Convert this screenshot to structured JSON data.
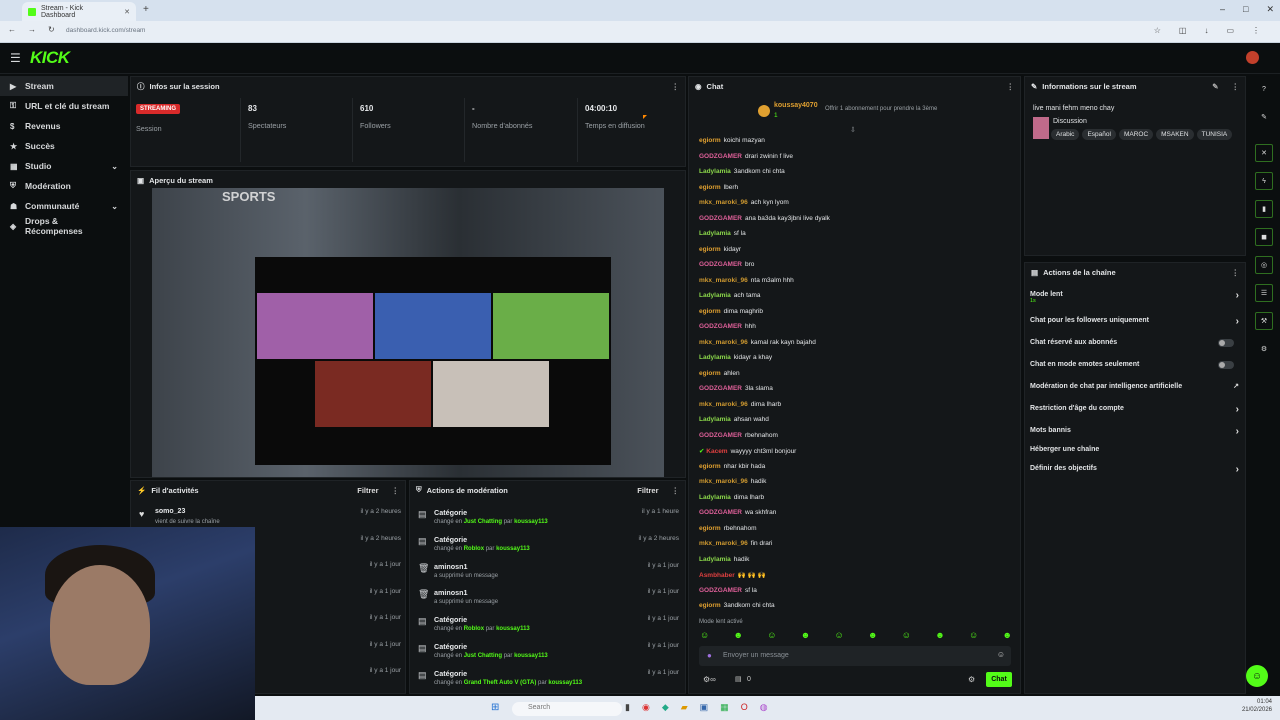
{
  "browser": {
    "tab_title": "Stream - Kick Dashboard",
    "new_tab": "+",
    "url": "dashboard.kick.com/stream",
    "win_controls": [
      "–",
      "□",
      "✕"
    ]
  },
  "app": {
    "logo": "KICK",
    "menu_icon": "hamburger-icon"
  },
  "sidebar": {
    "items": [
      {
        "label": "Stream",
        "icon": "video-icon",
        "active": true
      },
      {
        "label": "URL et clé du stream",
        "icon": "key-icon"
      },
      {
        "label": "Revenus",
        "icon": "money-icon"
      },
      {
        "label": "Succès",
        "icon": "trophy-icon"
      },
      {
        "label": "Studio",
        "icon": "studio-icon",
        "expand": true
      },
      {
        "label": "Modération",
        "icon": "shield-icon"
      },
      {
        "label": "Communauté",
        "icon": "users-icon",
        "expand": true
      },
      {
        "label": "Drops & Récompenses",
        "icon": "gift-icon"
      }
    ]
  },
  "session": {
    "title": "Infos sur la session",
    "badge": "STREAMING",
    "badge_label": "Session",
    "stats": [
      {
        "value": "83",
        "label": "Spectateurs"
      },
      {
        "value": "610",
        "label": "Followers"
      },
      {
        "value": "-",
        "label": "Nombre d'abonnés"
      },
      {
        "value": "04:00:10",
        "label": "Temps en diffusion"
      }
    ]
  },
  "preview": {
    "title": "Aperçu du stream",
    "overlay_text": "SPORTS"
  },
  "activity": {
    "title": "Fil d'activités",
    "filter": "Filtrer",
    "items": [
      {
        "user": "somo_23",
        "text": "vient de suivre la chaîne",
        "time": "il y a 2 heures"
      },
      {
        "time": "il y a 2 heures"
      },
      {
        "time": "il y a 1 jour"
      },
      {
        "time": "il y a 1 jour"
      },
      {
        "time": "il y a 1 jour"
      },
      {
        "time": "il y a 1 jour"
      },
      {
        "time": "il y a 1 jour"
      }
    ]
  },
  "moderation": {
    "title": "Actions de modération",
    "filter": "Filtrer",
    "items": [
      {
        "title": "Catégorie",
        "pre": "changé en",
        "a": "Just Chatting",
        "mid": "par",
        "b": "koussay113",
        "time": "il y a 1 heure",
        "icon": "category-icon"
      },
      {
        "title": "Catégorie",
        "pre": "changé en",
        "a": "Roblox",
        "mid": "par",
        "b": "koussay113",
        "time": "il y a 2 heures",
        "icon": "category-icon"
      },
      {
        "title": "aminosn1",
        "pre": "a supprimé un message",
        "time": "il y a 1 jour",
        "icon": "trash-icon"
      },
      {
        "title": "aminosn1",
        "pre": "a supprimé un message",
        "time": "il y a 1 jour",
        "icon": "trash-icon"
      },
      {
        "title": "Catégorie",
        "pre": "changé en",
        "a": "Roblox",
        "mid": "par",
        "b": "koussay113",
        "time": "il y a 1 jour",
        "icon": "category-icon"
      },
      {
        "title": "Catégorie",
        "pre": "changé en",
        "a": "Just Chatting",
        "mid": "par",
        "b": "koussay113",
        "time": "il y a 1 jour",
        "icon": "category-icon"
      },
      {
        "title": "Catégorie",
        "pre": "changé en",
        "a": "Grand Theft Auto V (GTA)",
        "mid": "par",
        "b": "koussay113",
        "time": "il y a 1 jour",
        "icon": "category-icon"
      }
    ]
  },
  "chat": {
    "title": "Chat",
    "pinned_user": "koussay4070",
    "pinned_count": "1",
    "gift_text": "Offrir 1 abonnement pour prendre la 3ème",
    "messages": [
      {
        "u": "egiorm",
        "c": "#e0a030",
        "t": "koichi mazyan"
      },
      {
        "u": "GODZGAMER",
        "c": "#e0609a",
        "t": "drari zwinin f live"
      },
      {
        "u": "Ladylamia",
        "c": "#8ad64a",
        "t": "3andkom chi chta"
      },
      {
        "u": "egiorm",
        "c": "#e0a030",
        "t": "lberh"
      },
      {
        "u": "mkx_maroki_96",
        "c": "#d09a30",
        "t": "ach kyn lyom"
      },
      {
        "u": "GODZGAMER",
        "c": "#e0609a",
        "t": "ana ba3da kay3jbni live dyalk"
      },
      {
        "u": "Ladylamia",
        "c": "#8ad64a",
        "t": "sf la"
      },
      {
        "u": "egiorm",
        "c": "#e0a030",
        "t": "kidayr"
      },
      {
        "u": "GODZGAMER",
        "c": "#e0609a",
        "t": "bro"
      },
      {
        "u": "mkx_maroki_96",
        "c": "#d09a30",
        "t": "nta m3alm hhh"
      },
      {
        "u": "Ladylamia",
        "c": "#8ad64a",
        "t": "ach tama"
      },
      {
        "u": "egiorm",
        "c": "#e0a030",
        "t": "dima maghrib"
      },
      {
        "u": "GODZGAMER",
        "c": "#e0609a",
        "t": "hhh"
      },
      {
        "u": "mkx_maroki_96",
        "c": "#d09a30",
        "t": "kamal rak kayn bajahd"
      },
      {
        "u": "Ladylamia",
        "c": "#8ad64a",
        "t": "kidayr a khay"
      },
      {
        "u": "egiorm",
        "c": "#e0a030",
        "t": "ahlen"
      },
      {
        "u": "GODZGAMER",
        "c": "#e0609a",
        "t": "3la slama"
      },
      {
        "u": "mkx_maroki_96",
        "c": "#d09a30",
        "t": "dima lharb"
      },
      {
        "u": "Ladylamia",
        "c": "#8ad64a",
        "t": "ahsan wahd"
      },
      {
        "u": "GODZGAMER",
        "c": "#e0609a",
        "t": "rbehnahom"
      },
      {
        "u": "Kacem",
        "c": "#e04040",
        "t": "wayyyy cht3ml bonjour"
      },
      {
        "u": "egiorm",
        "c": "#e0a030",
        "t": "nhar kbir hada"
      },
      {
        "u": "mkx_maroki_96",
        "c": "#d09a30",
        "t": "hadik"
      },
      {
        "u": "Ladylamia",
        "c": "#8ad64a",
        "t": "dima lharb"
      },
      {
        "u": "GODZGAMER",
        "c": "#e0609a",
        "t": "wa skhfran"
      },
      {
        "u": "egiorm",
        "c": "#e0a030",
        "t": "rbehnahom"
      },
      {
        "u": "mkx_maroki_96",
        "c": "#d09a30",
        "t": "fin drari"
      },
      {
        "u": "Ladylamia",
        "c": "#8ad64a",
        "t": "hadik"
      },
      {
        "u": "Asmbhaber",
        "c": "#e04040",
        "t": "🙌 🙌 🙌"
      },
      {
        "u": "GODZGAMER",
        "c": "#e0609a",
        "t": "sf la"
      },
      {
        "u": "egiorm",
        "c": "#e0a030",
        "t": "3andkom chi chta"
      }
    ],
    "slow_mode": "Mode lent activé",
    "input_placeholder": "Envoyer un message",
    "send_label": "Chat",
    "viewer_count": "0"
  },
  "stream_info": {
    "title": "Informations sur le stream",
    "stream_title": "live mani fehm meno chay",
    "category": "Discussion",
    "tags": [
      "Arabic",
      "Español",
      "MAROC",
      "MSAKEN",
      "TUNISIA"
    ]
  },
  "channel_actions": {
    "title": "Actions de la chaîne",
    "items": [
      {
        "label": "Mode lent",
        "sub": "1s",
        "kind": "chev"
      },
      {
        "label": "Chat pour les followers uniquement",
        "kind": "chev"
      },
      {
        "label": "Chat réservé aux abonnés",
        "kind": "toggle"
      },
      {
        "label": "Chat en mode emotes seulement",
        "kind": "toggle"
      },
      {
        "label": "Modération de chat par intelligence artificielle",
        "kind": "ext"
      },
      {
        "label": "Restriction d'âge du compte",
        "kind": "chev"
      },
      {
        "label": "Mots bannis",
        "kind": "chev"
      },
      {
        "label": "Héberger une chaîne",
        "kind": "none"
      },
      {
        "label": "Définir des objectifs",
        "kind": "chev"
      }
    ]
  },
  "taskbar": {
    "search": "Search",
    "time": "01:04",
    "date": "21/02/2026"
  },
  "colors": {
    "accent": "#53fc18",
    "live": "#d92a2a",
    "bg": "#0b0e0f"
  }
}
